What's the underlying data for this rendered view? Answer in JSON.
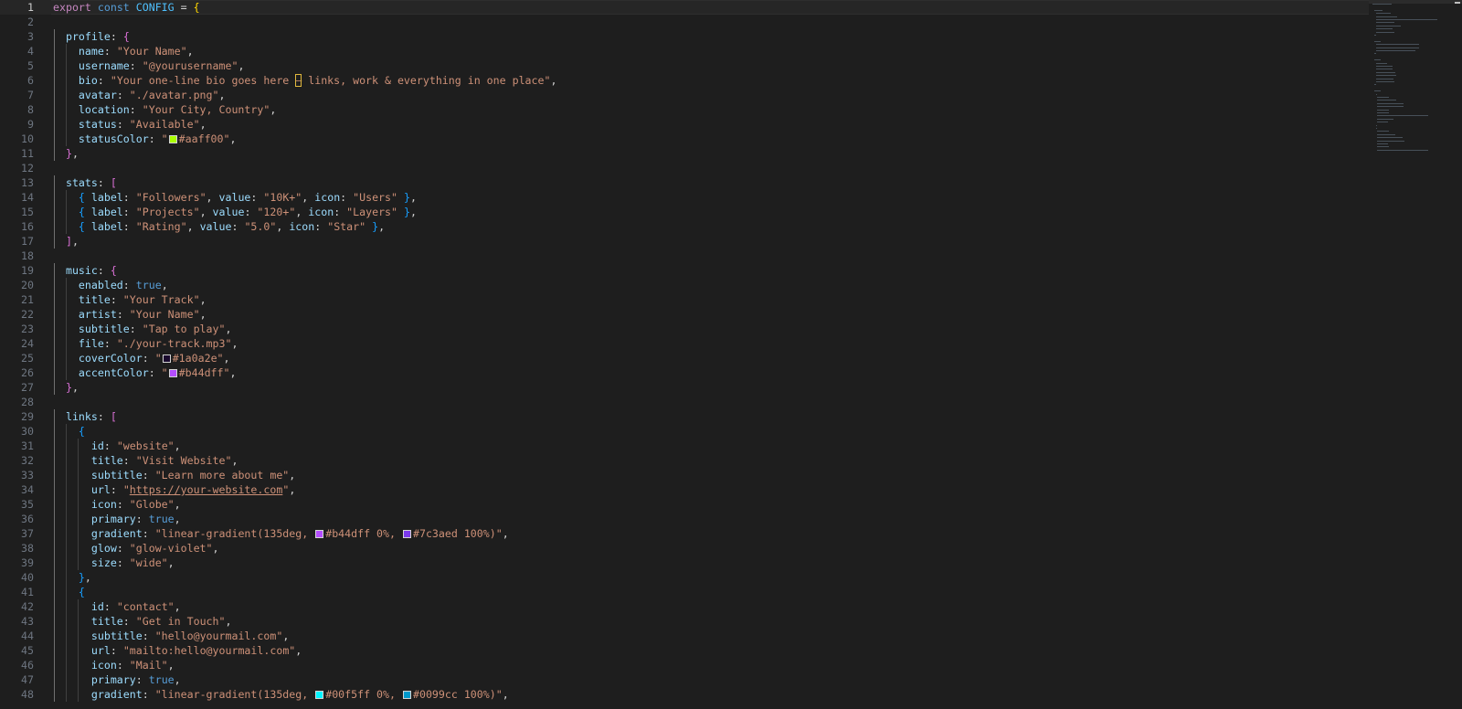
{
  "editor": {
    "active_line": 1,
    "lines": [
      [
        [
          "kwc",
          "export"
        ],
        [
          "p",
          " "
        ],
        [
          "kw",
          "const"
        ],
        [
          "p",
          " "
        ],
        [
          "cst",
          "CONFIG"
        ],
        [
          "p",
          " = "
        ],
        [
          "b1",
          "{"
        ]
      ],
      [],
      [
        [
          "p",
          "  "
        ],
        [
          "prop",
          "profile"
        ],
        [
          "p",
          ": "
        ],
        [
          "b2",
          "{"
        ]
      ],
      [
        [
          "p",
          "    "
        ],
        [
          "prop",
          "name"
        ],
        [
          "p",
          ": "
        ],
        [
          "str",
          "\"Your Name\""
        ],
        [
          "p",
          ","
        ]
      ],
      [
        [
          "p",
          "    "
        ],
        [
          "prop",
          "username"
        ],
        [
          "p",
          ": "
        ],
        [
          "str",
          "\"@yourusername\""
        ],
        [
          "p",
          ","
        ]
      ],
      [
        [
          "p",
          "    "
        ],
        [
          "prop",
          "bio"
        ],
        [
          "p",
          ": "
        ],
        [
          "str",
          "\"Your one-line bio goes here "
        ],
        [
          "hl",
          "—"
        ],
        [
          "str",
          " links, work & everything in one place\""
        ],
        [
          "p",
          ","
        ]
      ],
      [
        [
          "p",
          "    "
        ],
        [
          "prop",
          "avatar"
        ],
        [
          "p",
          ": "
        ],
        [
          "str",
          "\"./avatar.png\""
        ],
        [
          "p",
          ","
        ]
      ],
      [
        [
          "p",
          "    "
        ],
        [
          "prop",
          "location"
        ],
        [
          "p",
          ": "
        ],
        [
          "str",
          "\"Your City, Country\""
        ],
        [
          "p",
          ","
        ]
      ],
      [
        [
          "p",
          "    "
        ],
        [
          "prop",
          "status"
        ],
        [
          "p",
          ": "
        ],
        [
          "str",
          "\"Available\""
        ],
        [
          "p",
          ","
        ]
      ],
      [
        [
          "p",
          "    "
        ],
        [
          "prop",
          "statusColor"
        ],
        [
          "p",
          ": "
        ],
        [
          "str",
          "\""
        ],
        [
          "sw",
          "#aaff00"
        ],
        [
          "str",
          "#aaff00\""
        ],
        [
          "p",
          ","
        ]
      ],
      [
        [
          "p",
          "  "
        ],
        [
          "b2",
          "}"
        ],
        [
          "p",
          ","
        ]
      ],
      [],
      [
        [
          "p",
          "  "
        ],
        [
          "prop",
          "stats"
        ],
        [
          "p",
          ": "
        ],
        [
          "b2",
          "["
        ]
      ],
      [
        [
          "p",
          "    "
        ],
        [
          "b3",
          "{"
        ],
        [
          "p",
          " "
        ],
        [
          "prop",
          "label"
        ],
        [
          "p",
          ": "
        ],
        [
          "str",
          "\"Followers\""
        ],
        [
          "p",
          ", "
        ],
        [
          "prop",
          "value"
        ],
        [
          "p",
          ": "
        ],
        [
          "str",
          "\"10K+\""
        ],
        [
          "p",
          ", "
        ],
        [
          "prop",
          "icon"
        ],
        [
          "p",
          ": "
        ],
        [
          "str",
          "\"Users\""
        ],
        [
          "p",
          " "
        ],
        [
          "b3",
          "}"
        ],
        [
          "p",
          ","
        ]
      ],
      [
        [
          "p",
          "    "
        ],
        [
          "b3",
          "{"
        ],
        [
          "p",
          " "
        ],
        [
          "prop",
          "label"
        ],
        [
          "p",
          ": "
        ],
        [
          "str",
          "\"Projects\""
        ],
        [
          "p",
          ", "
        ],
        [
          "prop",
          "value"
        ],
        [
          "p",
          ": "
        ],
        [
          "str",
          "\"120+\""
        ],
        [
          "p",
          ", "
        ],
        [
          "prop",
          "icon"
        ],
        [
          "p",
          ": "
        ],
        [
          "str",
          "\"Layers\""
        ],
        [
          "p",
          " "
        ],
        [
          "b3",
          "}"
        ],
        [
          "p",
          ","
        ]
      ],
      [
        [
          "p",
          "    "
        ],
        [
          "b3",
          "{"
        ],
        [
          "p",
          " "
        ],
        [
          "prop",
          "label"
        ],
        [
          "p",
          ": "
        ],
        [
          "str",
          "\"Rating\""
        ],
        [
          "p",
          ", "
        ],
        [
          "prop",
          "value"
        ],
        [
          "p",
          ": "
        ],
        [
          "str",
          "\"5.0\""
        ],
        [
          "p",
          ", "
        ],
        [
          "prop",
          "icon"
        ],
        [
          "p",
          ": "
        ],
        [
          "str",
          "\"Star\""
        ],
        [
          "p",
          " "
        ],
        [
          "b3",
          "}"
        ],
        [
          "p",
          ","
        ]
      ],
      [
        [
          "p",
          "  "
        ],
        [
          "b2",
          "]"
        ],
        [
          "p",
          ","
        ]
      ],
      [],
      [
        [
          "p",
          "  "
        ],
        [
          "prop",
          "music"
        ],
        [
          "p",
          ": "
        ],
        [
          "b2",
          "{"
        ]
      ],
      [
        [
          "p",
          "    "
        ],
        [
          "prop",
          "enabled"
        ],
        [
          "p",
          ": "
        ],
        [
          "bool",
          "true"
        ],
        [
          "p",
          ","
        ]
      ],
      [
        [
          "p",
          "    "
        ],
        [
          "prop",
          "title"
        ],
        [
          "p",
          ": "
        ],
        [
          "str",
          "\"Your Track\""
        ],
        [
          "p",
          ","
        ]
      ],
      [
        [
          "p",
          "    "
        ],
        [
          "prop",
          "artist"
        ],
        [
          "p",
          ": "
        ],
        [
          "str",
          "\"Your Name\""
        ],
        [
          "p",
          ","
        ]
      ],
      [
        [
          "p",
          "    "
        ],
        [
          "prop",
          "subtitle"
        ],
        [
          "p",
          ": "
        ],
        [
          "str",
          "\"Tap to play\""
        ],
        [
          "p",
          ","
        ]
      ],
      [
        [
          "p",
          "    "
        ],
        [
          "prop",
          "file"
        ],
        [
          "p",
          ": "
        ],
        [
          "str",
          "\"./your-track.mp3\""
        ],
        [
          "p",
          ","
        ]
      ],
      [
        [
          "p",
          "    "
        ],
        [
          "prop",
          "coverColor"
        ],
        [
          "p",
          ": "
        ],
        [
          "str",
          "\""
        ],
        [
          "sw",
          "#1a0a2e"
        ],
        [
          "str",
          "#1a0a2e\""
        ],
        [
          "p",
          ","
        ]
      ],
      [
        [
          "p",
          "    "
        ],
        [
          "prop",
          "accentColor"
        ],
        [
          "p",
          ": "
        ],
        [
          "str",
          "\""
        ],
        [
          "sw",
          "#b44dff"
        ],
        [
          "str",
          "#b44dff\""
        ],
        [
          "p",
          ","
        ]
      ],
      [
        [
          "p",
          "  "
        ],
        [
          "b2",
          "}"
        ],
        [
          "p",
          ","
        ]
      ],
      [],
      [
        [
          "p",
          "  "
        ],
        [
          "prop",
          "links"
        ],
        [
          "p",
          ": "
        ],
        [
          "b2",
          "["
        ]
      ],
      [
        [
          "p",
          "    "
        ],
        [
          "b3",
          "{"
        ]
      ],
      [
        [
          "p",
          "      "
        ],
        [
          "prop",
          "id"
        ],
        [
          "p",
          ": "
        ],
        [
          "str",
          "\"website\""
        ],
        [
          "p",
          ","
        ]
      ],
      [
        [
          "p",
          "      "
        ],
        [
          "prop",
          "title"
        ],
        [
          "p",
          ": "
        ],
        [
          "str",
          "\"Visit Website\""
        ],
        [
          "p",
          ","
        ]
      ],
      [
        [
          "p",
          "      "
        ],
        [
          "prop",
          "subtitle"
        ],
        [
          "p",
          ": "
        ],
        [
          "str",
          "\"Learn more about me\""
        ],
        [
          "p",
          ","
        ]
      ],
      [
        [
          "p",
          "      "
        ],
        [
          "prop",
          "url"
        ],
        [
          "p",
          ": "
        ],
        [
          "str",
          "\""
        ],
        [
          "link",
          "https://your-website.com"
        ],
        [
          "str",
          "\""
        ],
        [
          "p",
          ","
        ]
      ],
      [
        [
          "p",
          "      "
        ],
        [
          "prop",
          "icon"
        ],
        [
          "p",
          ": "
        ],
        [
          "str",
          "\"Globe\""
        ],
        [
          "p",
          ","
        ]
      ],
      [
        [
          "p",
          "      "
        ],
        [
          "prop",
          "primary"
        ],
        [
          "p",
          ": "
        ],
        [
          "bool",
          "true"
        ],
        [
          "p",
          ","
        ]
      ],
      [
        [
          "p",
          "      "
        ],
        [
          "prop",
          "gradient"
        ],
        [
          "p",
          ": "
        ],
        [
          "str",
          "\"linear-gradient(135deg, "
        ],
        [
          "sw",
          "#b44dff"
        ],
        [
          "str",
          "#b44dff 0%, "
        ],
        [
          "sw",
          "#7c3aed"
        ],
        [
          "str",
          "#7c3aed 100%)\""
        ],
        [
          "p",
          ","
        ]
      ],
      [
        [
          "p",
          "      "
        ],
        [
          "prop",
          "glow"
        ],
        [
          "p",
          ": "
        ],
        [
          "str",
          "\"glow-violet\""
        ],
        [
          "p",
          ","
        ]
      ],
      [
        [
          "p",
          "      "
        ],
        [
          "prop",
          "size"
        ],
        [
          "p",
          ": "
        ],
        [
          "str",
          "\"wide\""
        ],
        [
          "p",
          ","
        ]
      ],
      [
        [
          "p",
          "    "
        ],
        [
          "b3",
          "}"
        ],
        [
          "p",
          ","
        ]
      ],
      [
        [
          "p",
          "    "
        ],
        [
          "b3",
          "{"
        ]
      ],
      [
        [
          "p",
          "      "
        ],
        [
          "prop",
          "id"
        ],
        [
          "p",
          ": "
        ],
        [
          "str",
          "\"contact\""
        ],
        [
          "p",
          ","
        ]
      ],
      [
        [
          "p",
          "      "
        ],
        [
          "prop",
          "title"
        ],
        [
          "p",
          ": "
        ],
        [
          "str",
          "\"Get in Touch\""
        ],
        [
          "p",
          ","
        ]
      ],
      [
        [
          "p",
          "      "
        ],
        [
          "prop",
          "subtitle"
        ],
        [
          "p",
          ": "
        ],
        [
          "str",
          "\"hello@yourmail.com\""
        ],
        [
          "p",
          ","
        ]
      ],
      [
        [
          "p",
          "      "
        ],
        [
          "prop",
          "url"
        ],
        [
          "p",
          ": "
        ],
        [
          "str",
          "\"mailto:hello@yourmail.com\""
        ],
        [
          "p",
          ","
        ]
      ],
      [
        [
          "p",
          "      "
        ],
        [
          "prop",
          "icon"
        ],
        [
          "p",
          ": "
        ],
        [
          "str",
          "\"Mail\""
        ],
        [
          "p",
          ","
        ]
      ],
      [
        [
          "p",
          "      "
        ],
        [
          "prop",
          "primary"
        ],
        [
          "p",
          ": "
        ],
        [
          "bool",
          "true"
        ],
        [
          "p",
          ","
        ]
      ],
      [
        [
          "p",
          "      "
        ],
        [
          "prop",
          "gradient"
        ],
        [
          "p",
          ": "
        ],
        [
          "str",
          "\"linear-gradient(135deg, "
        ],
        [
          "sw",
          "#00f5ff"
        ],
        [
          "str",
          "#00f5ff 0%, "
        ],
        [
          "sw",
          "#0099cc"
        ],
        [
          "str",
          "#0099cc 100%)\""
        ],
        [
          "p",
          ","
        ]
      ]
    ]
  },
  "colors": {
    "background": "#1e1e1e",
    "keyword": "#569cd6",
    "string": "#ce9178",
    "property": "#9cdcfe"
  }
}
